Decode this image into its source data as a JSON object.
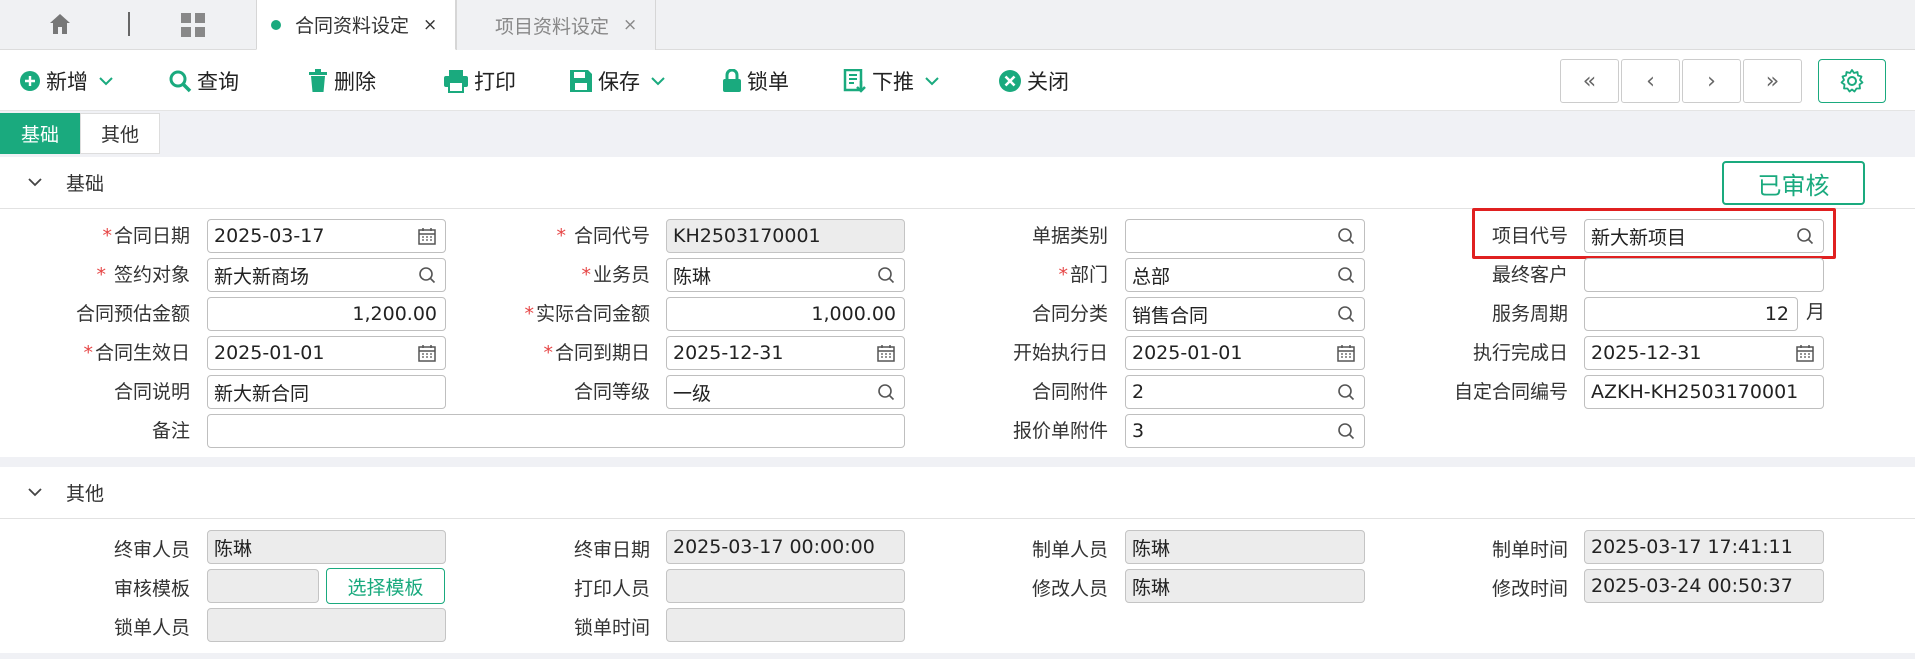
{
  "tabbar": {
    "active_tab": "合同资料设定",
    "inactive_tab": "项目资料设定",
    "close_glyph": "×",
    "icons": [
      "home-icon",
      "grid-icon"
    ]
  },
  "toolbar": {
    "add": "新增",
    "query": "查询",
    "delete": "删除",
    "print": "打印",
    "save": "保存",
    "lock": "锁单",
    "push": "下推",
    "close": "关闭",
    "nav": [
      "«",
      "‹",
      "›",
      "»"
    ]
  },
  "subtabs": [
    "基础",
    "其他"
  ],
  "status": "已审核",
  "sections": {
    "basic_title": "基础",
    "other_title": "其他"
  },
  "basic": {
    "contract_date": {
      "label": "合同日期",
      "value": "2025-03-17"
    },
    "contract_no": {
      "label": "合同代号",
      "value": "KH2503170001"
    },
    "doc_type": {
      "label": "单据类别",
      "value": ""
    },
    "project_code": {
      "label": "项目代号",
      "value": "新大新项目"
    },
    "sign_target": {
      "label": "签约对象",
      "value": "新大新商场"
    },
    "salesperson": {
      "label": "业务员",
      "value": "陈琳"
    },
    "department": {
      "label": "部门",
      "value": "总部"
    },
    "final_customer": {
      "label": "最终客户",
      "value": ""
    },
    "est_amount": {
      "label": "合同预估金额",
      "value": "1,200.00"
    },
    "actual_amount": {
      "label": "实际合同金额",
      "value": "1,000.00"
    },
    "category": {
      "label": "合同分类",
      "value": "销售合同"
    },
    "service_period": {
      "label": "服务周期",
      "value": "12",
      "unit": "月"
    },
    "effective_date": {
      "label": "合同生效日",
      "value": "2025-01-01"
    },
    "expiry_date": {
      "label": "合同到期日",
      "value": "2025-12-31"
    },
    "start_exec": {
      "label": "开始执行日",
      "value": "2025-01-01"
    },
    "end_exec": {
      "label": "执行完成日",
      "value": "2025-12-31"
    },
    "description": {
      "label": "合同说明",
      "value": "新大新合同"
    },
    "grade": {
      "label": "合同等级",
      "value": "一级"
    },
    "attachment": {
      "label": "合同附件",
      "value": "2"
    },
    "custom_no": {
      "label": "自定合同编号",
      "value": "AZKH-KH2503170001"
    },
    "remark": {
      "label": "备注",
      "value": ""
    },
    "quote_attachment": {
      "label": "报价单附件",
      "value": "3"
    }
  },
  "other": {
    "final_reviewer": {
      "label": "终审人员",
      "value": "陈琳"
    },
    "final_review_date": {
      "label": "终审日期",
      "value": "2025-03-17 00:00:00"
    },
    "creator": {
      "label": "制单人员",
      "value": "陈琳"
    },
    "create_time": {
      "label": "制单时间",
      "value": "2025-03-17 17:41:11"
    },
    "review_template": {
      "label": "审核模板",
      "value": "",
      "button": "选择模板"
    },
    "printer": {
      "label": "打印人员",
      "value": ""
    },
    "modifier": {
      "label": "修改人员",
      "value": "陈琳"
    },
    "modify_time": {
      "label": "修改时间",
      "value": "2025-03-24 00:50:37"
    },
    "locker": {
      "label": "锁单人员",
      "value": ""
    },
    "lock_time": {
      "label": "锁单时间",
      "value": ""
    }
  },
  "colors": {
    "accent": "#1aaa7e",
    "required": "#e64545",
    "highlight": "#e02020"
  }
}
